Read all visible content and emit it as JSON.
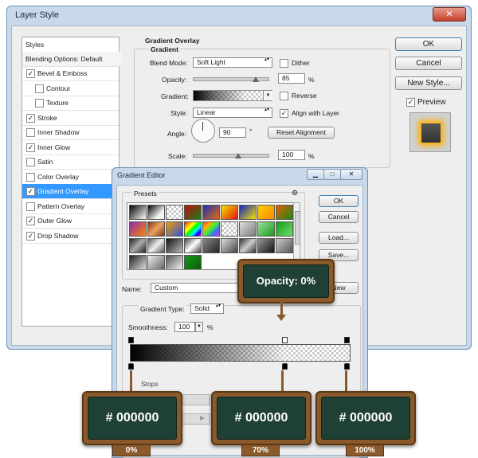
{
  "layer_style": {
    "title": "Layer Style",
    "close_symbol": "✕",
    "styles_header": "Styles",
    "blending_options": "Blending Options: Default",
    "items": [
      {
        "label": "Bevel & Emboss",
        "checked": true,
        "indent": false
      },
      {
        "label": "Contour",
        "checked": false,
        "indent": true
      },
      {
        "label": "Texture",
        "checked": false,
        "indent": true
      },
      {
        "label": "Stroke",
        "checked": true,
        "indent": false
      },
      {
        "label": "Inner Shadow",
        "checked": false,
        "indent": false
      },
      {
        "label": "Inner Glow",
        "checked": true,
        "indent": false
      },
      {
        "label": "Satin",
        "checked": false,
        "indent": false
      },
      {
        "label": "Color Overlay",
        "checked": false,
        "indent": false
      },
      {
        "label": "Gradient Overlay",
        "checked": true,
        "indent": false,
        "selected": true
      },
      {
        "label": "Pattern Overlay",
        "checked": false,
        "indent": false
      },
      {
        "label": "Outer Glow",
        "checked": true,
        "indent": false
      },
      {
        "label": "Drop Shadow",
        "checked": true,
        "indent": false
      }
    ],
    "panel": {
      "section_title": "Gradient Overlay",
      "group_title": "Gradient",
      "blend_mode_label": "Blend Mode:",
      "blend_mode_value": "Soft Light",
      "dither_label": "Dither",
      "opacity_label": "Opacity:",
      "opacity_value": "85",
      "percent": "%",
      "reverse_label": "Reverse",
      "gradient_label": "Gradient:",
      "style_label": "Style:",
      "style_value": "Linear",
      "align_label": "Align with Layer",
      "angle_label": "Angle:",
      "angle_value": "90",
      "degree": "°",
      "reset_alignment": "Reset Alignment",
      "scale_label": "Scale:",
      "scale_value": "100"
    },
    "buttons": {
      "ok": "OK",
      "cancel": "Cancel",
      "new_style": "New Style...",
      "preview": "Preview"
    }
  },
  "gradient_editor": {
    "title": "Gradient Editor",
    "presets_label": "Presets",
    "ok": "OK",
    "reset": "Cancel",
    "load": "Load...",
    "save": "Save...",
    "name_label": "Name:",
    "name_value": "Custom",
    "new_button": "New",
    "gradient_type_label": "Gradient Type:",
    "gradient_type_value": "Solid",
    "smoothness_label": "Smoothness:",
    "smoothness_value": "100",
    "percent": "%",
    "stops_label": "Stops"
  },
  "annotations": {
    "opacity": "Opacity: 0%",
    "stop_left_color": "# 000000",
    "stop_mid_color": "# 000000",
    "stop_right_color": "# 000000",
    "stop_left_pos": "0%",
    "stop_mid_pos": "70%",
    "stop_right_pos": "100%"
  },
  "colors": {
    "accent": "#3399ff",
    "board": "#1f4034",
    "wood": "#8a5a2c",
    "glow": "#f5b82e"
  }
}
